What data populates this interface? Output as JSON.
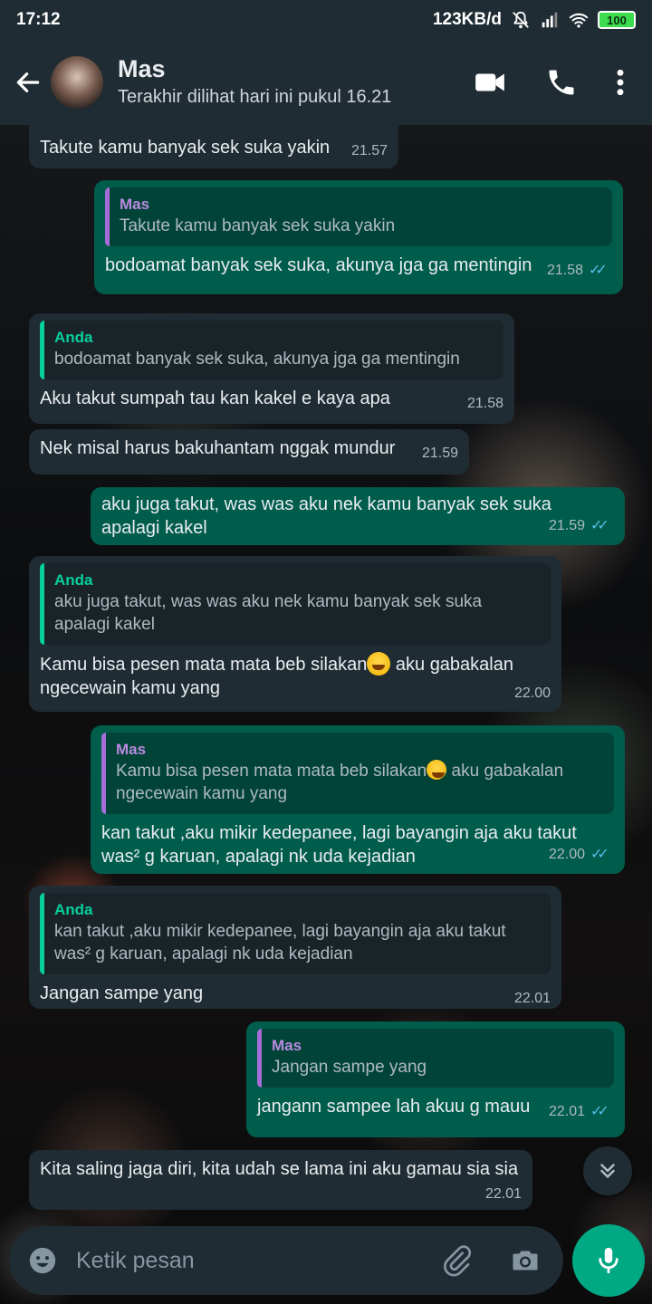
{
  "status_bar": {
    "time": "17:12",
    "network_speed": "123KB/d",
    "battery": "100",
    "icons": [
      "mute-icon",
      "signal-icon",
      "wifi-icon",
      "battery-icon"
    ]
  },
  "header": {
    "contact_name": "Mas",
    "last_seen": "Terakhir dilihat hari ini pukul 16.21",
    "icons": [
      "back-arrow-icon",
      "video-call-icon",
      "voice-call-icon",
      "more-options-icon"
    ]
  },
  "messages": [
    {
      "direction": "in",
      "text": "Takute kamu banyak sek suka yakin",
      "time": "21.57"
    },
    {
      "direction": "out",
      "quote_name": "Mas",
      "quote_text": "Takute kamu banyak sek suka yakin",
      "text": "bodoamat banyak sek suka, akunya jga ga mentingin",
      "time": "21.58",
      "status": "read"
    },
    {
      "direction": "in",
      "quote_name": "Anda",
      "quote_text": "bodoamat banyak sek suka, akunya jga ga mentingin",
      "text": "Aku takut sumpah tau kan kakel e kaya apa",
      "time": "21.58"
    },
    {
      "direction": "in",
      "text": "Nek misal harus bakuhantam nggak mundur",
      "time": "21.59"
    },
    {
      "direction": "out",
      "text": "aku juga takut, was was aku nek kamu banyak sek suka apalagi kakel",
      "time": "21.59",
      "status": "read"
    },
    {
      "direction": "in",
      "quote_name": "Anda",
      "quote_text": "aku juga takut, was was aku nek kamu banyak sek suka apalagi kakel",
      "text_before_emoji": "Kamu bisa pesen mata mata beb silakan",
      "text_after_emoji": " aku gabakalan ngecewain kamu yang",
      "emoji": "laughing-emoji",
      "time": "22.00"
    },
    {
      "direction": "out",
      "quote_name": "Mas",
      "quote_text_before_emoji": "Kamu bisa pesen mata mata beb silakan",
      "quote_text_after_emoji": " aku gabakalan ngecewain kamu yang",
      "text": "kan takut ,aku mikir kedepanee, lagi bayangin aja aku takut was² g karuan, apalagi nk uda kejadian",
      "time": "22.00",
      "status": "read"
    },
    {
      "direction": "in",
      "quote_name": "Anda",
      "quote_text": "kan takut ,aku mikir kedepanee, lagi bayangin aja aku takut was² g karuan, apalagi nk uda kejadian",
      "text": "Jangan sampe yang",
      "time": "22.01"
    },
    {
      "direction": "out",
      "quote_name": "Mas",
      "quote_text": "Jangan sampe yang",
      "text": "jangann sampee lah akuu g mauu",
      "time": "22.01",
      "status": "read"
    },
    {
      "direction": "in",
      "text": "Kita saling jaga diri, kita udah se lama ini aku gamau sia sia",
      "time": "22.01"
    }
  ],
  "composer": {
    "placeholder": "Ketik pesan",
    "icons": [
      "emoji-icon",
      "attach-icon",
      "camera-icon",
      "mic-icon"
    ]
  },
  "scroll_down_icon": "chevron-double-down-icon",
  "colors": {
    "header_bg": "#1f2c33",
    "incoming_bubble": "#1f2c33",
    "outgoing_bubble": "#005c4b",
    "accent": "#00a884",
    "read_ticks": "#53bdeb",
    "quote_anda": "#06cf9c",
    "quote_mas": "#a66cd8"
  }
}
